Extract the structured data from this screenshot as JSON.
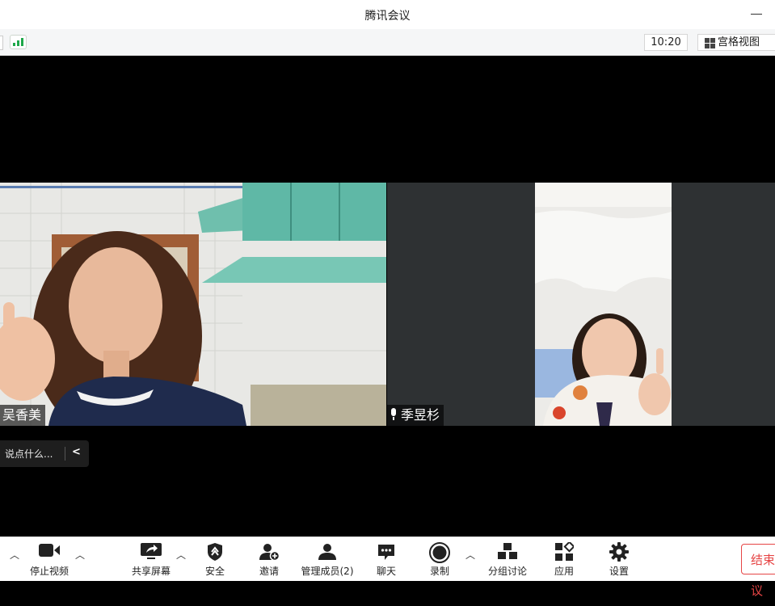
{
  "window": {
    "title": "腾讯会议"
  },
  "topbar": {
    "time": "10:20",
    "view_label": "宫格视图"
  },
  "participants": [
    {
      "name": "吴香美"
    },
    {
      "name": "季昱杉"
    }
  ],
  "chat": {
    "placeholder": "说点什么..."
  },
  "toolbar": {
    "items": [
      {
        "label": "停止视频"
      },
      {
        "label": "共享屏幕"
      },
      {
        "label": "安全"
      },
      {
        "label": "邀请"
      },
      {
        "label": "管理成员(2)"
      },
      {
        "label": "聊天"
      },
      {
        "label": "录制"
      },
      {
        "label": "分组讨论"
      },
      {
        "label": "应用"
      },
      {
        "label": "设置"
      }
    ],
    "end_label": "结束会议"
  },
  "colors": {
    "signal": "#1ea84a",
    "end": "#e64545",
    "icon": "#222222"
  }
}
